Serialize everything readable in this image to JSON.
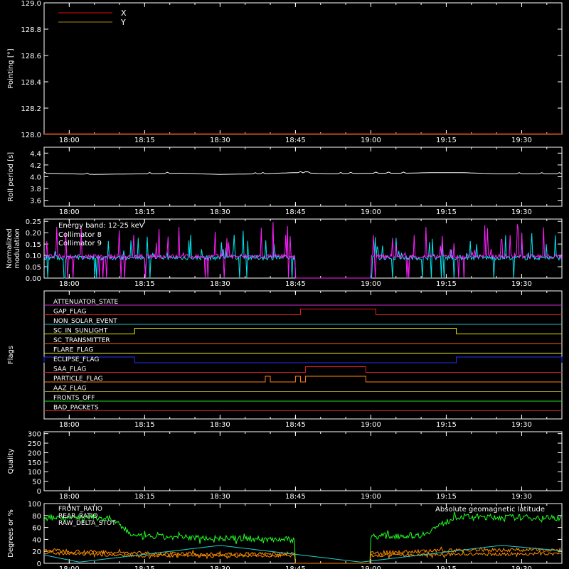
{
  "colors": {
    "background": "#000000",
    "axes": "#ffffff",
    "x_red": "#e01010",
    "y_olive": "#a08a20",
    "roll": "#ffffff",
    "collimator8": "#00e5f0",
    "collimator9": "#ff20ff",
    "front_ratio": "#20ff20",
    "rear_ratio": "#ff8c00",
    "geomag": "#20d0d0"
  },
  "time_axis": {
    "range": [
      "17:55",
      "19:38"
    ],
    "ticks": [
      "18:00",
      "18:15",
      "18:30",
      "18:45",
      "19:00",
      "19:15",
      "19:30"
    ]
  },
  "chart_data": [
    {
      "type": "line",
      "ylabel": "Pointing [°]",
      "ylim": [
        128.0,
        129.0
      ],
      "yticks": [
        "128.0",
        "128.2",
        "128.4",
        "128.6",
        "128.8",
        "129.0"
      ],
      "legend": {
        "placement": "top-left"
      },
      "series": [
        {
          "name": "X",
          "color_key": "x_red",
          "x": [
            "17:55",
            "19:38"
          ],
          "y": [
            128.0,
            128.0
          ]
        },
        {
          "name": "Y",
          "color_key": "y_olive",
          "x": [
            "17:55",
            "19:38"
          ],
          "y": [
            128.0,
            128.0
          ]
        }
      ]
    },
    {
      "type": "line",
      "ylabel": "Roll period [s]",
      "ylim": [
        3.5,
        4.5
      ],
      "yticks": [
        "3.6",
        "3.8",
        "4.0",
        "4.2",
        "4.4"
      ],
      "series": [
        {
          "color_key": "roll",
          "x": [
            "17:55",
            "18:05",
            "18:15",
            "18:22",
            "18:30",
            "18:38",
            "18:45",
            "18:52",
            "19:00",
            "19:07",
            "19:12",
            "19:18",
            "19:25",
            "19:38"
          ],
          "y": [
            4.06,
            4.04,
            4.05,
            4.06,
            4.04,
            4.05,
            4.07,
            4.05,
            4.06,
            4.06,
            4.07,
            4.07,
            4.05,
            4.05
          ]
        }
      ]
    },
    {
      "type": "line",
      "ylabel": [
        "Normalized",
        "modulation"
      ],
      "ylim": [
        0.0,
        0.26
      ],
      "yticks": [
        "0.00",
        "0.05",
        "0.10",
        "0.15",
        "0.20",
        "0.25"
      ],
      "legend": {
        "placement": "top-left",
        "title": "Energy band: 12-25 keV"
      },
      "gaps": [
        [
          "18:45",
          "19:00"
        ]
      ],
      "series": [
        {
          "name": "Collimator 8",
          "color_key": "collimator8",
          "baseline": 0.09,
          "dropout": 0.0,
          "max": 0.21
        },
        {
          "name": "Collimator 9",
          "color_key": "collimator9",
          "baseline": 0.095,
          "dropout": 0.0,
          "max": 0.25
        }
      ]
    },
    {
      "type": "line",
      "ylabel": "Flags",
      "flags": [
        {
          "name": "ATTENUATOR_STATE",
          "color": "#cc33cc",
          "segments": []
        },
        {
          "name": "GAP_FLAG",
          "color": "#e02020",
          "segments": [
            [
              "18:46",
              "19:01"
            ]
          ]
        },
        {
          "name": "NON_SOLAR_EVENT",
          "color": "#20c0c0",
          "segments": []
        },
        {
          "name": "SC_IN_SUNLIGHT",
          "color": "#e8e800",
          "segments": [
            [
              "18:13",
              "19:17"
            ]
          ]
        },
        {
          "name": "SC_TRANSMITTER",
          "color": "#ff6010",
          "segments": []
        },
        {
          "name": "FLARE_FLAG",
          "color": "#f0f020",
          "segments": []
        },
        {
          "name": "ECLIPSE_FLAG",
          "color": "#2030ff",
          "segments": [
            [
              "17:55",
              "18:13"
            ],
            [
              "19:17",
              "19:38"
            ]
          ]
        },
        {
          "name": "SAA_FLAG",
          "color": "#e02020",
          "segments": [
            [
              "18:47",
              "18:59"
            ]
          ]
        },
        {
          "name": "PARTICLE_FLAG",
          "color": "#ff8010",
          "segments": [
            [
              "18:39",
              "18:40"
            ],
            [
              "18:45",
              "18:46"
            ],
            [
              "18:47",
              "18:59"
            ]
          ]
        },
        {
          "name": "AAZ_FLAG",
          "color": "#a08a20",
          "segments": []
        },
        {
          "name": "FRONTS_OFF",
          "color": "#20e020",
          "segments": []
        },
        {
          "name": "BAD_PACKETS",
          "color": "#e02020",
          "segments": []
        }
      ]
    },
    {
      "type": "line",
      "ylabel": "Quality",
      "ylim": [
        0,
        310
      ],
      "yticks": [
        "0",
        "50",
        "100",
        "150",
        "200",
        "250",
        "300"
      ],
      "series": []
    },
    {
      "type": "line",
      "ylabel": "Degrees or %",
      "ylim": [
        0,
        100
      ],
      "yticks": [
        "0",
        "20",
        "40",
        "60",
        "80",
        "100"
      ],
      "legend": {
        "placement": "top-left"
      },
      "legend_right": "Absolute geomagnetic latitude",
      "gaps": [
        [
          "18:45",
          "19:00"
        ]
      ],
      "series": [
        {
          "name": "FRONT_RATIO",
          "color_key": "front_ratio",
          "x": [
            "17:55",
            "18:08",
            "18:13",
            "18:30",
            "18:45",
            "19:00",
            "19:10",
            "19:17",
            "19:38"
          ],
          "y": [
            78,
            76,
            45,
            42,
            40,
            45,
            47,
            78,
            76
          ]
        },
        {
          "name": "REAR_RATIO",
          "color_key": "rear_ratio",
          "x": [
            "17:55",
            "18:13",
            "18:30",
            "18:45",
            "19:00",
            "19:17",
            "19:38"
          ],
          "y": [
            22,
            17,
            15,
            16,
            17,
            22,
            23
          ]
        },
        {
          "name": "RAW_DELTA_STOT",
          "color_key": "rear_ratio",
          "x": [
            "17:55",
            "18:13",
            "18:30",
            "18:45",
            "19:00",
            "19:17",
            "19:38"
          ],
          "y": [
            17,
            13,
            12,
            13,
            13,
            15,
            16
          ]
        },
        {
          "name": "Absolute geomagnetic latitude",
          "color_key": "geomag",
          "x": [
            "17:55",
            "18:02",
            "18:30",
            "18:58",
            "19:26",
            "19:38"
          ],
          "y": [
            14,
            2,
            30,
            2,
            30,
            21
          ]
        }
      ]
    }
  ]
}
